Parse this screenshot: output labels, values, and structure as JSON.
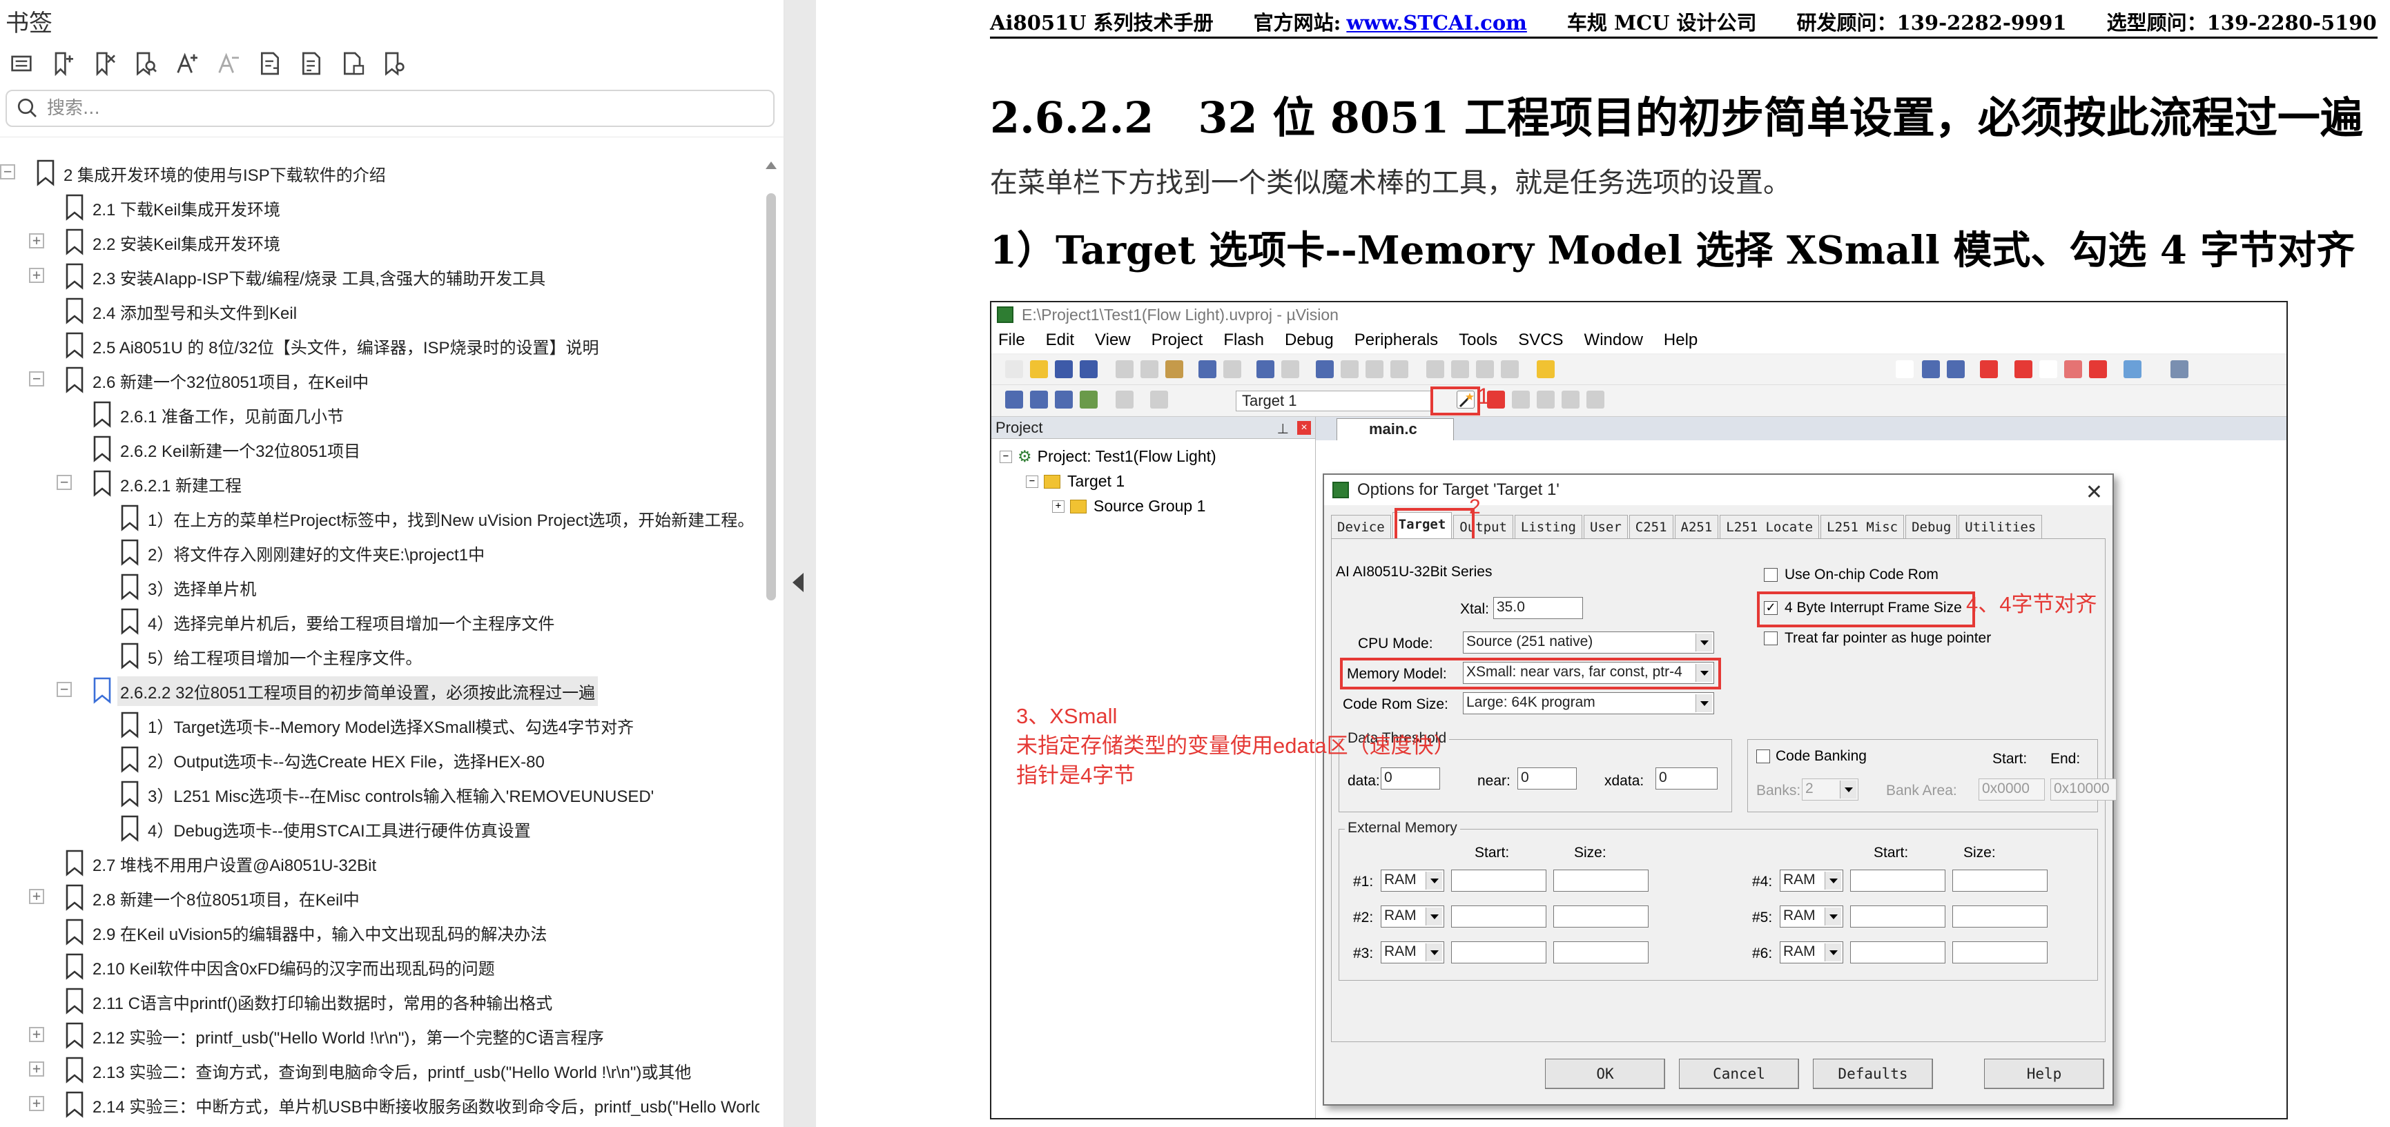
{
  "sidebar": {
    "title": "书签",
    "search_placeholder": "搜索...",
    "toolbar_icons": [
      "expand-all-icon",
      "add-bookmark-icon",
      "delete-bookmark-icon",
      "bookmark-search-icon",
      "font-larger-icon",
      "font-smaller-icon",
      "export-icon",
      "import-icon",
      "page-icon",
      "bookmark-settings-icon"
    ],
    "items": [
      {
        "label": "2  集成开发环境的使用与ISP下载软件的介绍",
        "expander": "-"
      },
      {
        "label": "2.1 下载Keil集成开发环境",
        "expander": ""
      },
      {
        "label": "2.2  安装Keil集成开发环境",
        "expander": "+"
      },
      {
        "label": "2.3  安装AIapp-ISP下载/编程/烧录 工具,含强大的辅助开发工具",
        "expander": "+"
      },
      {
        "label": "2.4  添加型号和头文件到Keil",
        "expander": ""
      },
      {
        "label": "2.5  Ai8051U 的 8位/32位【头文件，编译器，ISP烧录时的设置】说明",
        "expander": ""
      },
      {
        "label": "2.6 新建一个32位8051项目，在Keil中",
        "expander": "-"
      },
      {
        "label": "2.6.1 准备工作，见前面几小节",
        "expander": ""
      },
      {
        "label": "2.6.2  Keil新建一个32位8051项目",
        "expander": ""
      },
      {
        "label": "2.6.2.1 新建工程",
        "expander": "-"
      },
      {
        "label": "1）在上方的菜单栏Project标签中，找到New uVision Project选项，开始新建工程。",
        "expander": ""
      },
      {
        "label": "2）将文件存入刚刚建好的文件夹E:\\project1中",
        "expander": ""
      },
      {
        "label": "3）选择单片机",
        "expander": ""
      },
      {
        "label": "4）选择完单片机后，要给工程项目增加一个主程序文件",
        "expander": ""
      },
      {
        "label": "5）给工程项目增加一个主程序文件。",
        "expander": ""
      },
      {
        "label": "2.6.2.2  32位8051工程项目的初步简单设置，必须按此流程过一遍",
        "expander": "-"
      },
      {
        "label": "1）Target选项卡--Memory Model选择XSmall模式、勾选4字节对齐",
        "expander": ""
      },
      {
        "label": "2）Output选项卡--勾选Create HEX File，选择HEX-80",
        "expander": ""
      },
      {
        "label": "3）L251 Misc选项卡--在Misc controls输入框输入'REMOVEUNUSED'",
        "expander": ""
      },
      {
        "label": "4）Debug选项卡--使用STCAI工具进行硬件仿真设置",
        "expander": ""
      },
      {
        "label": "2.7  堆栈不用用户设置@Ai8051U-32Bit",
        "expander": ""
      },
      {
        "label": "2.8  新建一个8位8051项目，在Keil中",
        "expander": "+"
      },
      {
        "label": "2.9  在Keil uVision5的编辑器中，输入中文出现乱码的解决办法",
        "expander": ""
      },
      {
        "label": "2.10  Keil软件中因含0xFD编码的汉字而出现乱码的问题",
        "expander": ""
      },
      {
        "label": "2.11  C语言中printf()函数打印输出数据时，常用的各种输出格式",
        "expander": ""
      },
      {
        "label": "2.12  实验一：printf_usb(\"Hello World !\\r\\n\")，第一个完整的C语言程序",
        "expander": "+"
      },
      {
        "label": "2.13  实验二：查询方式，查询到电脑命令后，printf_usb(\"Hello World !\\r\\n\")或其他",
        "expander": "+"
      },
      {
        "label": "2.14  实验三：中断方式，单片机USB中断接收服务函数收到命令后，printf_usb(\"Hello World",
        "expander": "+"
      }
    ]
  },
  "page": {
    "header": {
      "manual": "Ai8051U 系列技术手册",
      "website_label": "官方网站:",
      "website": "www.STCAI.com",
      "company": "车规 MCU 设计公司",
      "rd_consultant": "研发顾问：139-2282-9991",
      "selection_consultant": "选型顾问：139-2280-5190"
    },
    "section_number": "2.6.2.2",
    "section_title": "32 位 8051 工程项目的初步简单设置，必须按此流程过一遍",
    "intro": "在菜单栏下方找到一个类似魔术棒的工具，就是任务选项的设置。",
    "step_heading": "1）Target 选项卡--Memory Model 选择 XSmall 模式、勾选 4 字节对齐"
  },
  "uvision": {
    "window_title": "E:\\Project1\\Test1(Flow Light).uvproj - µVision",
    "menu": [
      "File",
      "Edit",
      "View",
      "Project",
      "Flash",
      "Debug",
      "Peripherals",
      "Tools",
      "SVCS",
      "Window",
      "Help"
    ],
    "target_combo": "Target 1",
    "project_panel_title": "Project",
    "project_root": "Project: Test1(Flow Light)",
    "target_node": "Target 1",
    "source_group": "Source Group 1",
    "editor_tab": "main.c",
    "dialog": {
      "title": "Options for Target 'Target 1'",
      "tabs": [
        "Device",
        "Target",
        "Output",
        "Listing",
        "User",
        "C251",
        "A251",
        "L251 Locate",
        "L251 Misc",
        "Debug",
        "Utilities"
      ],
      "series": "AI AI8051U-32Bit Series",
      "xtal_label": "Xtal:",
      "xtal": "35.0",
      "cpu_mode_label": "CPU Mode:",
      "cpu_mode": "Source (251 native)",
      "memory_model_label": "Memory Model:",
      "memory_model": "XSmall: near vars, far const, ptr-4",
      "code_rom_label": "Code Rom Size:",
      "code_rom": "Large: 64K program",
      "use_onchip_label": "Use On-chip Code Rom",
      "frame_size_label": "4 Byte Interrupt Frame Size",
      "far_pointer_label": "Treat far pointer as huge pointer",
      "data_threshold_title": "Data Threshold",
      "data_label": "data:",
      "data_val": "0",
      "near_label": "near:",
      "near_val": "0",
      "xdata_label": "xdata:",
      "xdata_val": "0",
      "code_banking_label": "Code Banking",
      "banks_label": "Banks:",
      "banks_val": "2",
      "bank_area_label": "Bank Area:",
      "start_label": "Start:",
      "end_label": "End:",
      "bank_start": "0x0000",
      "bank_end": "0x10000",
      "external_memory_title": "External Memory",
      "size_label": "Size:",
      "ext_rows": [
        {
          "label": "#1:",
          "type": "RAM"
        },
        {
          "label": "#2:",
          "type": "RAM"
        },
        {
          "label": "#3:",
          "type": "RAM"
        },
        {
          "label": "#4:",
          "type": "RAM"
        },
        {
          "label": "#5:",
          "type": "RAM"
        },
        {
          "label": "#6:",
          "type": "RAM"
        }
      ],
      "buttons": {
        "ok": "OK",
        "cancel": "Cancel",
        "defaults": "Defaults",
        "help": "Help"
      }
    },
    "annotations": {
      "n1": "1",
      "n2": "2",
      "n3_line1": "3、XSmall",
      "n3_line2": "未指定存储类型的变量使用edata区（速度快）",
      "n3_line3": "指针是4字节",
      "n4": "4、4字节对齐"
    }
  }
}
